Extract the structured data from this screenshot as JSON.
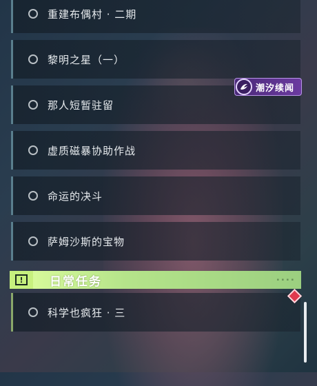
{
  "quests": [
    {
      "label": "重建布偶村 · 二期"
    },
    {
      "label": "黎明之星（一）"
    },
    {
      "label": "那人短暂驻留"
    },
    {
      "label": "虚质磁暴协助作战"
    },
    {
      "label": "命运的决斗"
    },
    {
      "label": "萨姆沙斯的宝物"
    }
  ],
  "badge": {
    "label": "潮汐续闻",
    "icon": "tide-emblem-icon"
  },
  "daily_section": {
    "title": "日常任务",
    "icon": "exclamation-box-icon",
    "items": [
      {
        "label": "科学也疯狂 · 三"
      }
    ]
  },
  "colors": {
    "section_accent": "#c7f07e",
    "badge_purple": "#6b3aa0",
    "alert_red": "#e03a4e"
  }
}
